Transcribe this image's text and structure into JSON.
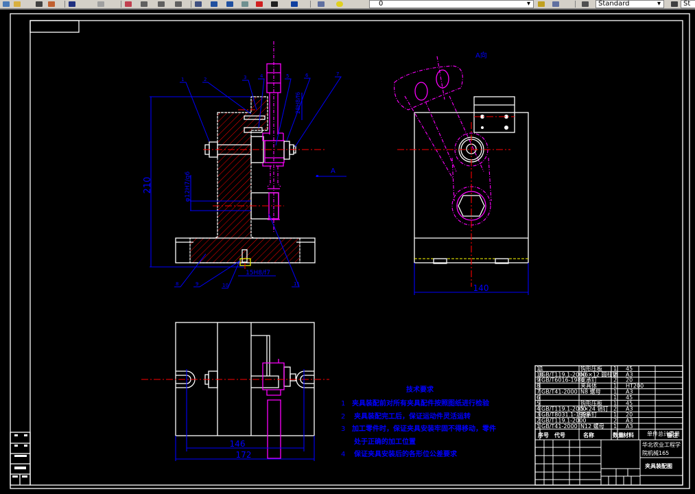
{
  "toolbar": {
    "layer_value": "0",
    "style_value": "Standard",
    "style2_value": "St",
    "icons": [
      "new-icon",
      "open-icon",
      "save-icon",
      "print-icon",
      "undo-icon",
      "redo-icon",
      "pan-icon",
      "zoom-realtime-icon",
      "zoom-window-icon",
      "zoom-previous-icon",
      "properties-icon",
      "design-center-icon",
      "tool-palette-icon",
      "sheet-set-icon",
      "markup-icon",
      "calculator-icon",
      "help-icon",
      "layer-manager-icon",
      "layer-state-icon",
      "make-current-icon",
      "layer-previous-icon",
      "text-style-icon",
      "dim-style-icon"
    ]
  },
  "colors": {
    "outline": "#ffffff",
    "hidden": "#ff00ff",
    "center": "#ff0000",
    "dimension": "#0000ff",
    "section_hatch": "#ff0000",
    "background": "#000000"
  },
  "views": {
    "direction_label": "A",
    "view_label": "A向"
  },
  "dimensions": {
    "height_210": "210",
    "bore": "φ12H7/g6",
    "pin": "15H8/f7",
    "bush": "28H8/f6",
    "width_140": "140",
    "slot_146": "146",
    "width_172": "172"
  },
  "balloons": {
    "top": [
      "1",
      "2",
      "3",
      "4",
      "5",
      "6",
      "7"
    ],
    "bottom": [
      "8",
      "9",
      "10",
      "11"
    ]
  },
  "tech_requirements": {
    "title": "技术要求",
    "items": [
      {
        "num": "1",
        "text": "夹具装配前对所有夹具配件按照图纸进行检验"
      },
      {
        "num": "2",
        "text": "夹具装配完工后，保证运动件灵活运转"
      },
      {
        "num": "3",
        "text": "加工零件时，保证夹具安装牢固不得移动，零件"
      },
      {
        "num": "",
        "text": "处于正确的加工位置"
      },
      {
        "num": "4",
        "text": "保证夹具安装后的各形位公差要求"
      }
    ]
  },
  "bom": {
    "rows": [
      {
        "no": "11",
        "code": "",
        "name": "钩形压板",
        "qty": "1",
        "material": "45"
      },
      {
        "no": "10",
        "code": "GB/T119.1-2000",
        "name": "N6×12 圆柱销",
        "qty": "2",
        "material": "A3"
      },
      {
        "no": "9",
        "code": "GB/T6016-1986",
        "name": "支承钉",
        "qty": "2",
        "material": "20"
      },
      {
        "no": "8",
        "code": "",
        "name": "夹具体",
        "qty": "1",
        "material": "HT200"
      },
      {
        "no": "7",
        "code": "GB/T41-2000",
        "name": "N8 螺母",
        "qty": "1",
        "material": "A3"
      },
      {
        "no": "6",
        "code": "",
        "name": "",
        "qty": "1",
        "material": "45"
      },
      {
        "no": "5",
        "code": "",
        "name": "钩形压板",
        "qty": "1",
        "material": "45"
      },
      {
        "no": "4",
        "code": "GB/T119.1-2000",
        "name": "5×24 销钉",
        "qty": "2",
        "material": "A3"
      },
      {
        "no": "3",
        "code": "GB/T8031.1-1999",
        "name": "支承钉",
        "qty": "1",
        "material": "20"
      },
      {
        "no": "2",
        "code": "GB/T119.1-2000",
        "name": "",
        "qty": "2",
        "material": "A3"
      },
      {
        "no": "1",
        "code": "GB/T41-2000",
        "name": "N12 螺母",
        "qty": "1",
        "material": "A3"
      }
    ],
    "headers": {
      "no": "序号",
      "code": "代号",
      "name": "名称",
      "qty": "数量",
      "material": "材料",
      "weight": "单件总计重量",
      "remark": "备注"
    }
  },
  "title_block": {
    "school_line1": "华北农业工程学",
    "school_line2": "院机械165",
    "drawing_title": "夹具装配图"
  }
}
